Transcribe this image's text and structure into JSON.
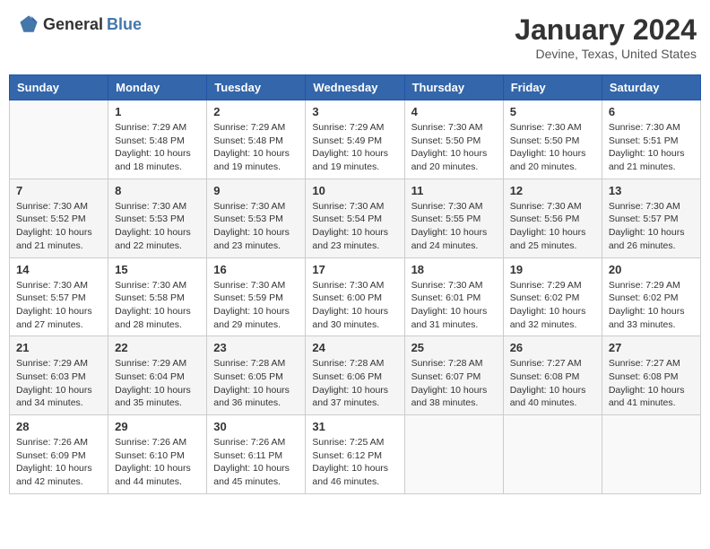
{
  "header": {
    "logo_general": "General",
    "logo_blue": "Blue",
    "month_year": "January 2024",
    "location": "Devine, Texas, United States"
  },
  "days_of_week": [
    "Sunday",
    "Monday",
    "Tuesday",
    "Wednesday",
    "Thursday",
    "Friday",
    "Saturday"
  ],
  "weeks": [
    [
      {
        "day": "",
        "info": ""
      },
      {
        "day": "1",
        "info": "Sunrise: 7:29 AM\nSunset: 5:48 PM\nDaylight: 10 hours\nand 18 minutes."
      },
      {
        "day": "2",
        "info": "Sunrise: 7:29 AM\nSunset: 5:48 PM\nDaylight: 10 hours\nand 19 minutes."
      },
      {
        "day": "3",
        "info": "Sunrise: 7:29 AM\nSunset: 5:49 PM\nDaylight: 10 hours\nand 19 minutes."
      },
      {
        "day": "4",
        "info": "Sunrise: 7:30 AM\nSunset: 5:50 PM\nDaylight: 10 hours\nand 20 minutes."
      },
      {
        "day": "5",
        "info": "Sunrise: 7:30 AM\nSunset: 5:50 PM\nDaylight: 10 hours\nand 20 minutes."
      },
      {
        "day": "6",
        "info": "Sunrise: 7:30 AM\nSunset: 5:51 PM\nDaylight: 10 hours\nand 21 minutes."
      }
    ],
    [
      {
        "day": "7",
        "info": "Sunrise: 7:30 AM\nSunset: 5:52 PM\nDaylight: 10 hours\nand 21 minutes."
      },
      {
        "day": "8",
        "info": "Sunrise: 7:30 AM\nSunset: 5:53 PM\nDaylight: 10 hours\nand 22 minutes."
      },
      {
        "day": "9",
        "info": "Sunrise: 7:30 AM\nSunset: 5:53 PM\nDaylight: 10 hours\nand 23 minutes."
      },
      {
        "day": "10",
        "info": "Sunrise: 7:30 AM\nSunset: 5:54 PM\nDaylight: 10 hours\nand 23 minutes."
      },
      {
        "day": "11",
        "info": "Sunrise: 7:30 AM\nSunset: 5:55 PM\nDaylight: 10 hours\nand 24 minutes."
      },
      {
        "day": "12",
        "info": "Sunrise: 7:30 AM\nSunset: 5:56 PM\nDaylight: 10 hours\nand 25 minutes."
      },
      {
        "day": "13",
        "info": "Sunrise: 7:30 AM\nSunset: 5:57 PM\nDaylight: 10 hours\nand 26 minutes."
      }
    ],
    [
      {
        "day": "14",
        "info": "Sunrise: 7:30 AM\nSunset: 5:57 PM\nDaylight: 10 hours\nand 27 minutes."
      },
      {
        "day": "15",
        "info": "Sunrise: 7:30 AM\nSunset: 5:58 PM\nDaylight: 10 hours\nand 28 minutes."
      },
      {
        "day": "16",
        "info": "Sunrise: 7:30 AM\nSunset: 5:59 PM\nDaylight: 10 hours\nand 29 minutes."
      },
      {
        "day": "17",
        "info": "Sunrise: 7:30 AM\nSunset: 6:00 PM\nDaylight: 10 hours\nand 30 minutes."
      },
      {
        "day": "18",
        "info": "Sunrise: 7:30 AM\nSunset: 6:01 PM\nDaylight: 10 hours\nand 31 minutes."
      },
      {
        "day": "19",
        "info": "Sunrise: 7:29 AM\nSunset: 6:02 PM\nDaylight: 10 hours\nand 32 minutes."
      },
      {
        "day": "20",
        "info": "Sunrise: 7:29 AM\nSunset: 6:02 PM\nDaylight: 10 hours\nand 33 minutes."
      }
    ],
    [
      {
        "day": "21",
        "info": "Sunrise: 7:29 AM\nSunset: 6:03 PM\nDaylight: 10 hours\nand 34 minutes."
      },
      {
        "day": "22",
        "info": "Sunrise: 7:29 AM\nSunset: 6:04 PM\nDaylight: 10 hours\nand 35 minutes."
      },
      {
        "day": "23",
        "info": "Sunrise: 7:28 AM\nSunset: 6:05 PM\nDaylight: 10 hours\nand 36 minutes."
      },
      {
        "day": "24",
        "info": "Sunrise: 7:28 AM\nSunset: 6:06 PM\nDaylight: 10 hours\nand 37 minutes."
      },
      {
        "day": "25",
        "info": "Sunrise: 7:28 AM\nSunset: 6:07 PM\nDaylight: 10 hours\nand 38 minutes."
      },
      {
        "day": "26",
        "info": "Sunrise: 7:27 AM\nSunset: 6:08 PM\nDaylight: 10 hours\nand 40 minutes."
      },
      {
        "day": "27",
        "info": "Sunrise: 7:27 AM\nSunset: 6:08 PM\nDaylight: 10 hours\nand 41 minutes."
      }
    ],
    [
      {
        "day": "28",
        "info": "Sunrise: 7:26 AM\nSunset: 6:09 PM\nDaylight: 10 hours\nand 42 minutes."
      },
      {
        "day": "29",
        "info": "Sunrise: 7:26 AM\nSunset: 6:10 PM\nDaylight: 10 hours\nand 44 minutes."
      },
      {
        "day": "30",
        "info": "Sunrise: 7:26 AM\nSunset: 6:11 PM\nDaylight: 10 hours\nand 45 minutes."
      },
      {
        "day": "31",
        "info": "Sunrise: 7:25 AM\nSunset: 6:12 PM\nDaylight: 10 hours\nand 46 minutes."
      },
      {
        "day": "",
        "info": ""
      },
      {
        "day": "",
        "info": ""
      },
      {
        "day": "",
        "info": ""
      }
    ]
  ]
}
